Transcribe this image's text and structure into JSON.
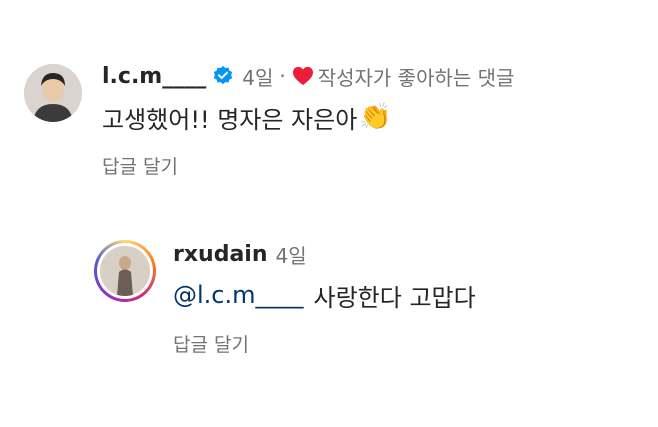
{
  "comment1": {
    "username": "l.c.m____",
    "time": "4일",
    "separator": "·",
    "liked_by_author": "작성자가 좋아하는 댓글",
    "text": "고생했어!! 명자은 자은아",
    "emoji": "👏",
    "reply_label": "답글 달기",
    "verified": true
  },
  "comment2": {
    "username": "rxudain",
    "time": "4일",
    "mention": "@l.c.m____",
    "text": "사랑한다 고맙다",
    "reply_label": "답글 달기",
    "has_story_ring": true
  },
  "colors": {
    "text": "#262626",
    "secondary": "#737373",
    "mention": "#00376b",
    "verified": "#0095f6",
    "heart": "#ed1c3a"
  }
}
